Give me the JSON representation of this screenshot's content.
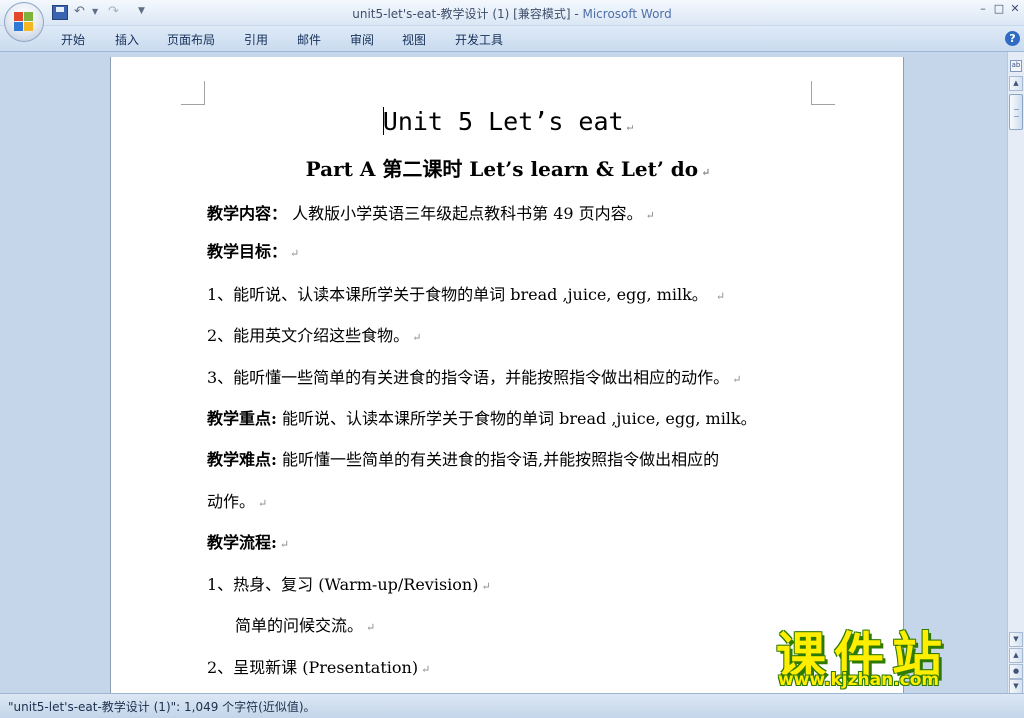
{
  "window": {
    "title_doc": "unit5-let's-eat-教学设计 (1) [兼容模式]",
    "title_sep": " - ",
    "title_app": "Microsoft Word",
    "minimize": "–",
    "maximize": "□",
    "close": "✕"
  },
  "quick_access": {
    "undo_icon": "↶",
    "redo_icon": "↷",
    "dropdown": "▼"
  },
  "ribbon": {
    "tabs": [
      "开始",
      "插入",
      "页面布局",
      "引用",
      "邮件",
      "审阅",
      "视图",
      "开发工具"
    ],
    "help": "?"
  },
  "document": {
    "title": "Unit 5  Let’s eat",
    "subtitle": "Part A 第二课时 Let’s learn & Let’ do",
    "paragraph_mark": "↵",
    "lines": [
      {
        "label": "教学内容：",
        "text": " 人教版小学英语三年级起点教科书第 49 页内容。"
      },
      {
        "label": "教学目标：",
        "text": ""
      },
      {
        "label": "",
        "text": "1、能听说、认读本课所学关于食物的单词 bread ,juice, egg, milk。    "
      },
      {
        "label": "",
        "text": "2、能用英文介绍这些食物。"
      },
      {
        "label": "",
        "text": "3、能听懂一些简单的有关进食的指令语，并能按照指令做出相应的动作。"
      },
      {
        "label": "教学重点:",
        "text": " 能听说、认读本课所学关于食物的单词 bread ,juice, egg, milk。"
      },
      {
        "label": "教学难点:",
        "text": " 能听懂一些简单的有关进食的指令语,并能按照指令做出相应的"
      },
      {
        "label": "",
        "text": "动作。"
      },
      {
        "label": "教学流程:",
        "text": ""
      },
      {
        "label": "",
        "text": "1、热身、复习 (Warm-up/Revision)"
      },
      {
        "label": "",
        "text": "简单的问候交流。"
      },
      {
        "label": "",
        "text": "2、呈现新课 (Presentation)"
      }
    ]
  },
  "status_bar": {
    "text": "\"unit5-let's-eat-教学设计 (1)\": 1,049 个字符(近似值)。"
  },
  "watermark": {
    "big": "课件站",
    "small": "www.kjzhan.com"
  },
  "scrollbar": {
    "up": "▲",
    "down": "▼",
    "prev_page": "▲",
    "select_browse": "●",
    "next_page": "▼",
    "ruler": "ab"
  }
}
